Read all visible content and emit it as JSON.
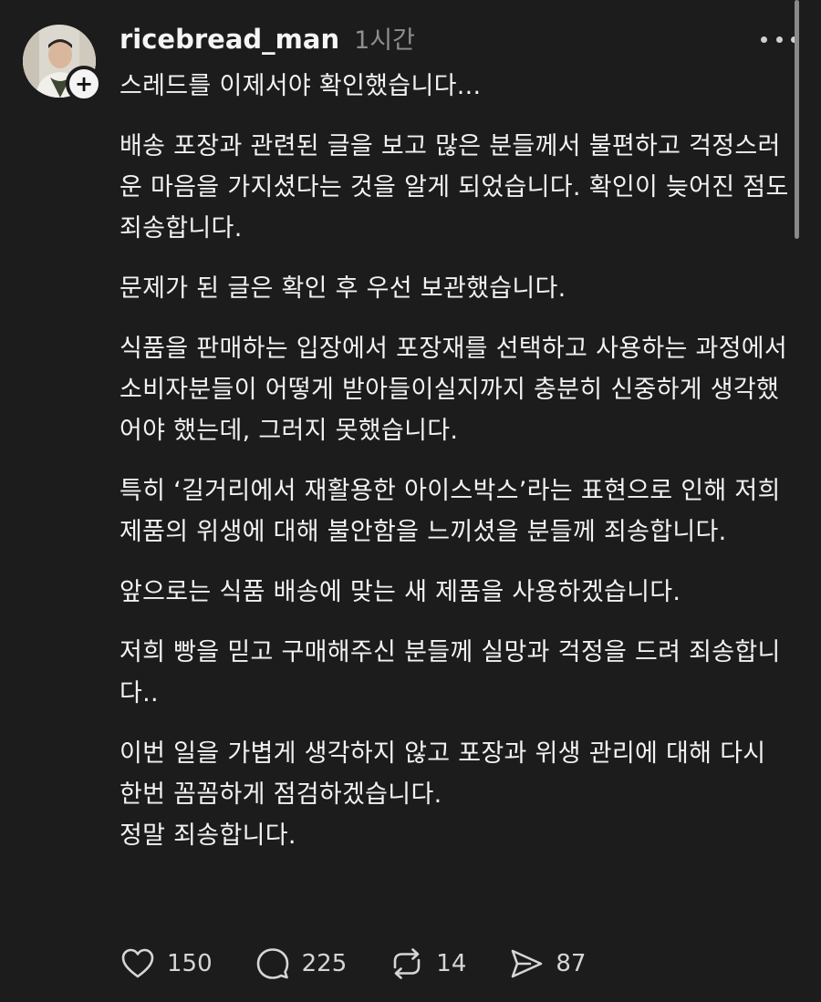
{
  "post": {
    "username": "ricebread_man",
    "timestamp": "1시간",
    "paragraphs": [
      "스레드를 이제서야 확인했습니다...",
      "배송 포장과 관련된 글을 보고 많은 분들께서 불편하고 걱정스러운 마음을 가지셨다는 것을 알게 되었습니다. 확인이 늦어진 점도 죄송합니다.",
      "문제가 된 글은 확인 후 우선 보관했습니다.",
      "식품을 판매하는 입장에서 포장재를 선택하고 사용하는 과정에서 소비자분들이 어떻게 받아들이실지까지 충분히 신중하게 생각했어야 했는데, 그러지 못했습니다.",
      "특히 ‘길거리에서 재활용한 아이스박스’라는 표현으로 인해 저희 제품의 위생에 대해 불안함을 느끼셨을 분들께 죄송합니다.",
      "앞으로는 식품 배송에 맞는 새 제품을 사용하겠습니다.",
      "저희 빵을 믿고 구매해주신 분들께 실망과 걱정을 드려 죄송합니다..",
      "이번 일을 가볍게 생각하지 않고 포장과 위생 관리에 대해 다시 한번 꼼꼼하게 점검하겠습니다.",
      "정말 죄송합니다."
    ]
  },
  "actions": {
    "likes": "150",
    "comments": "225",
    "reposts": "14",
    "shares": "87"
  },
  "icons": {
    "like": "heart-icon",
    "comment": "comment-bubble-icon",
    "repost": "repost-icon",
    "share": "send-icon",
    "more": "more-horizontal-icon",
    "follow": "plus-icon"
  }
}
